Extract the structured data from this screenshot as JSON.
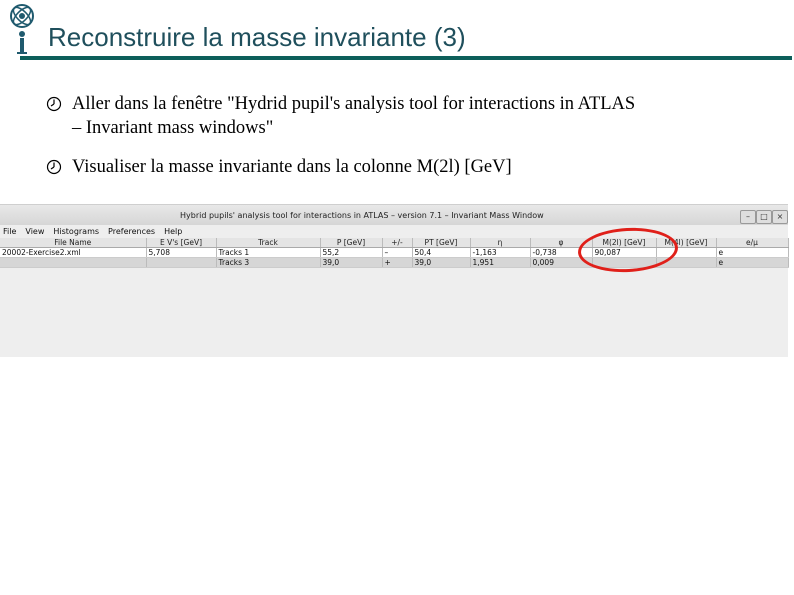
{
  "slide": {
    "title": "Reconstruire la masse invariante (3)",
    "bullets": [
      {
        "line1": "Aller dans la fenêtre \"Hydrid pupil's analysis tool for interactions in ATLAS",
        "line2": "– Invariant mass windows\""
      },
      {
        "line1": "Visualiser la masse invariante dans la colonne M(2l) [GeV]"
      }
    ],
    "colors": {
      "title": "#1f4f5c",
      "rule": "#0d5f5a",
      "highlight": "#e0201a"
    }
  },
  "window": {
    "title": "Hybrid pupils' analysis tool for interactions in ATLAS – version 7.1 – Invariant Mass Window",
    "menu": [
      "File",
      "View",
      "Histograms",
      "Preferences",
      "Help"
    ],
    "buttons": [
      "–",
      "□",
      "×"
    ],
    "columns": [
      "File Name",
      "E V's [GeV]",
      "Track",
      "P [GeV]",
      "+/-",
      "PT [GeV]",
      "η",
      "φ",
      "M(2l) [GeV]",
      "M(4l) [GeV]",
      "e/μ"
    ],
    "rows": [
      [
        "20002-Exercise2.xml",
        "5,708",
        "Tracks 1",
        "55,2",
        "–",
        "50,4",
        "-1,163",
        "-0,738",
        "90,087",
        "",
        "e"
      ],
      [
        "",
        "",
        "Tracks 3",
        "39,0",
        "+",
        "39,0",
        "1,951",
        "0,009",
        "",
        "",
        "e"
      ]
    ]
  }
}
